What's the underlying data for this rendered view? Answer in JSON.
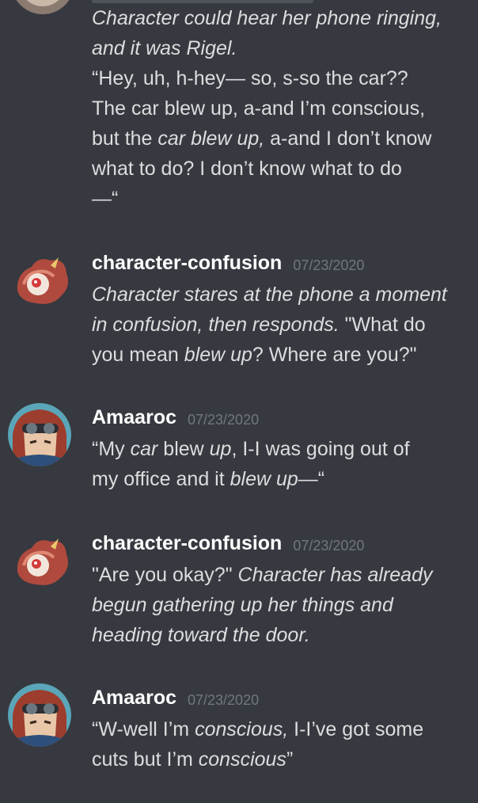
{
  "messages": [
    {
      "id": "m0",
      "lines": [
        [
          "Character could hear her phone ringing,"
        ],
        [
          "and it was Rigel."
        ],
        [
          "“Hey, uh, h-hey— so, s-so the car??"
        ],
        [
          "The car blew up, a-and I’m conscious,"
        ],
        [
          "but the ",
          "car blew up,",
          " a-and I don’t know"
        ],
        [
          "what to do? I don’t know what to do"
        ],
        [
          "—“"
        ]
      ]
    },
    {
      "id": "m1",
      "username": "character-confusion",
      "timestamp": "07/23/2020",
      "lines": [
        [
          "Character stares at the phone a moment"
        ],
        [
          "in confusion, then responds.",
          " \"What do"
        ],
        [
          "you mean ",
          "blew up",
          "? Where are you?\""
        ]
      ]
    },
    {
      "id": "m2",
      "username": "Amaaroc",
      "timestamp": "07/23/2020",
      "lines": [
        [
          "“My ",
          "car",
          " blew ",
          "up",
          ", I-I was going out of"
        ],
        [
          "my office and it ",
          "blew up",
          "—“"
        ]
      ]
    },
    {
      "id": "m3",
      "username": "character-confusion",
      "timestamp": "07/23/2020",
      "lines": [
        [
          "\"Are you okay?\" ",
          "Character has already"
        ],
        [
          "begun gathering up her things and"
        ],
        [
          "heading toward the door."
        ]
      ]
    },
    {
      "id": "m4",
      "username": "Amaaroc",
      "timestamp": "07/23/2020",
      "lines": [
        [
          "“W-well I’m ",
          "conscious,",
          " I-I’ve got some"
        ],
        [
          "cuts but I’m ",
          "conscious",
          "”"
        ]
      ]
    }
  ],
  "colors": {
    "background": "#36393f",
    "text": "#dcddde",
    "username": "#ffffff",
    "timestamp": "#72767d"
  },
  "icons": {
    "avatar_character_confusion": "red-bird-avatar",
    "avatar_amaaroc": "goggles-person-avatar"
  }
}
